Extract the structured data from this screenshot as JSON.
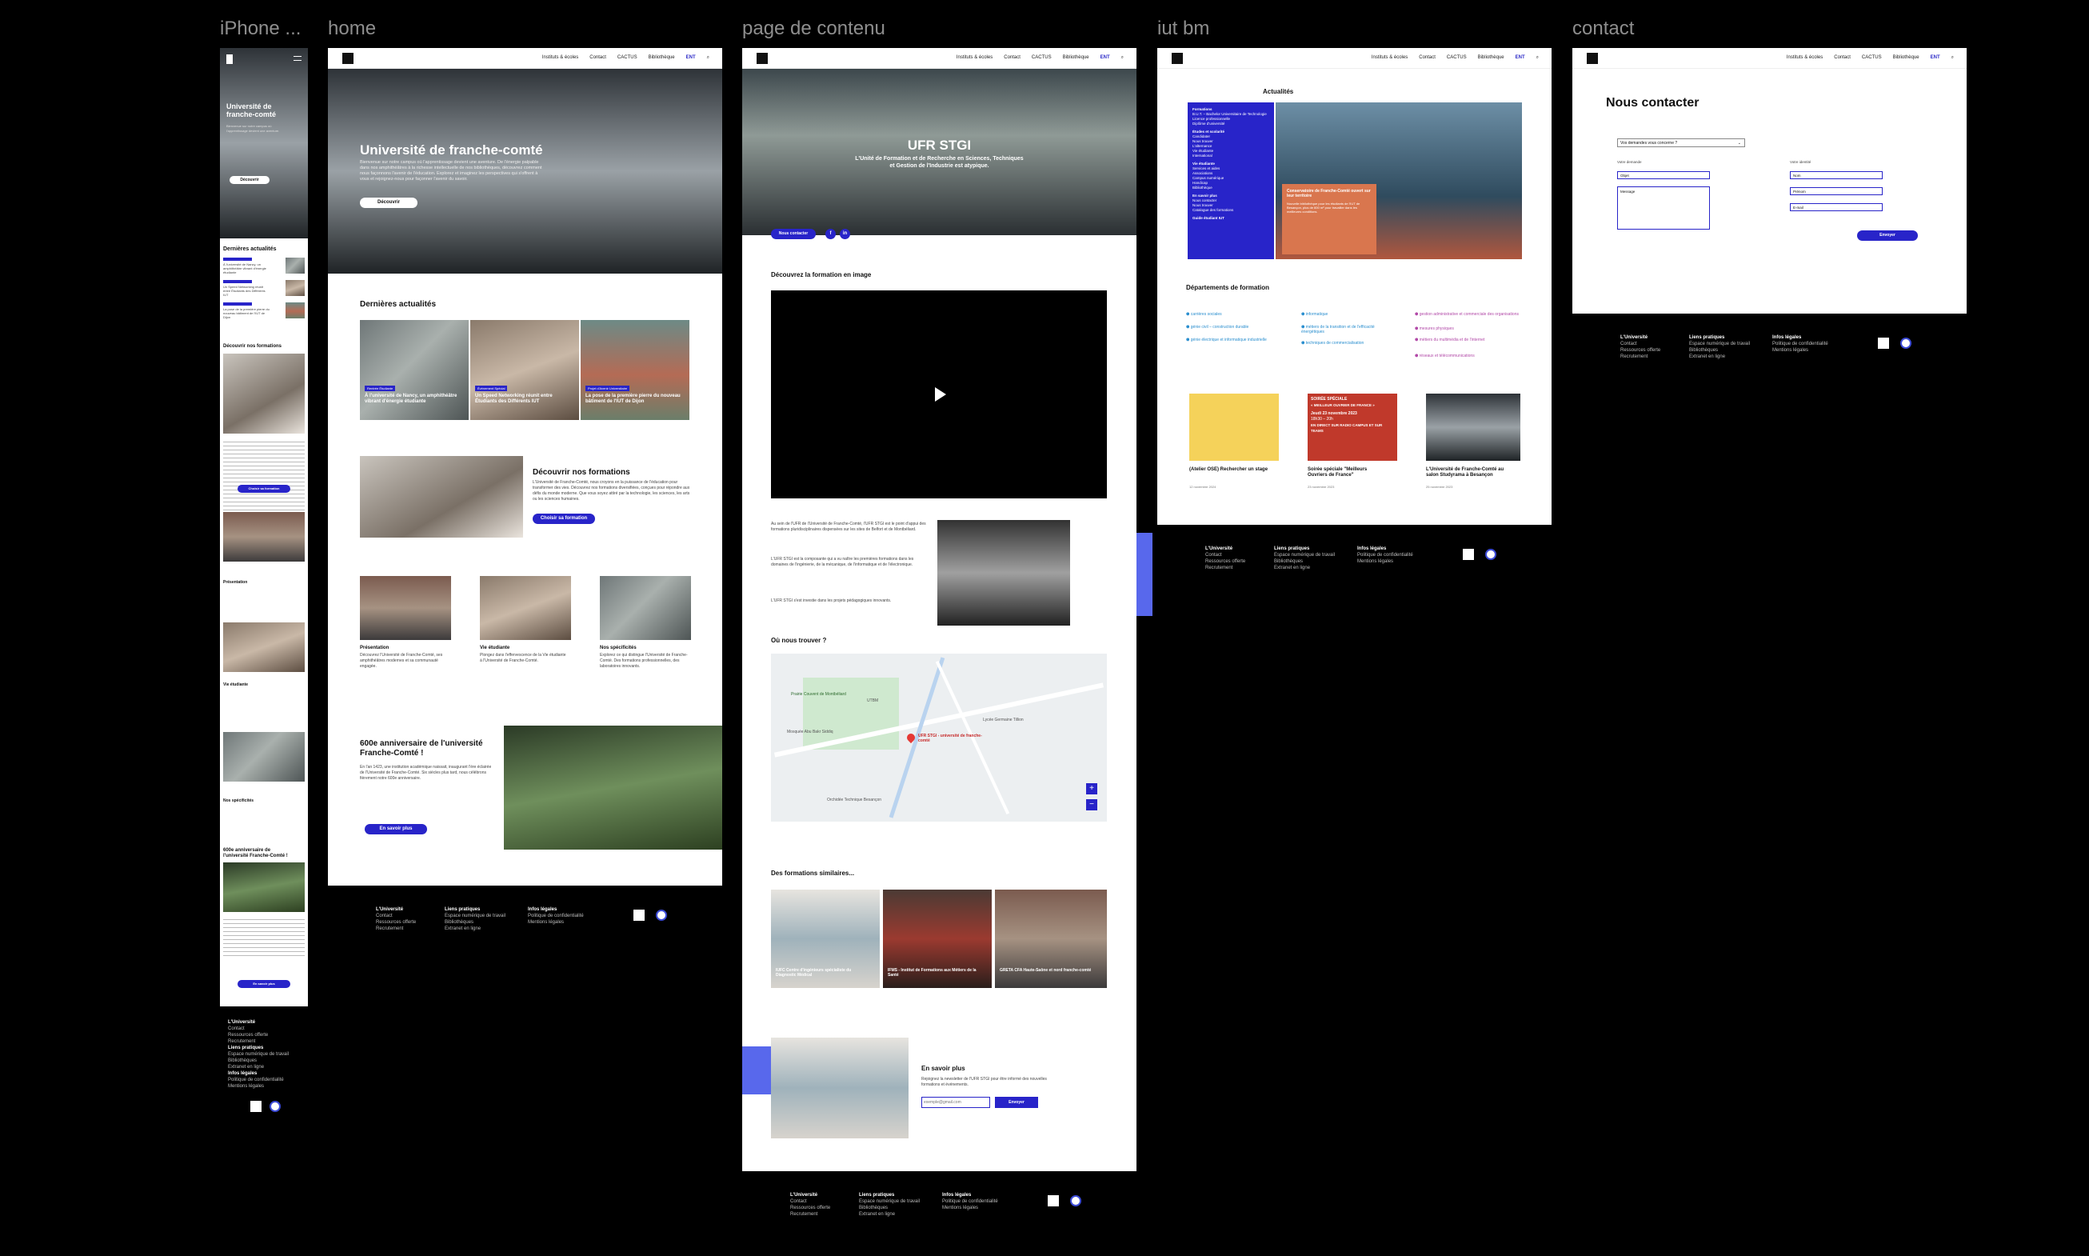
{
  "frames": {
    "iphone": "iPhone ...",
    "home": "home",
    "page": "page de contenu",
    "iut": "iut bm",
    "contact": "contact"
  },
  "nav": {
    "links": [
      "Instituts & écoles",
      "Contact",
      "CACTUS",
      "Bibliothèque",
      "ENT"
    ],
    "search_icon": "search-icon"
  },
  "iphone": {
    "hero_title": "Université de franche-comté",
    "hero_text": "Bienvenue sur notre campus où l'apprentissage devient une aventure.",
    "hero_button": "Découvrir",
    "news_title": "Dernières actualités",
    "news": [
      "À l'université de Nancy, un amphithéâtre vibrant d'énergie étudiante",
      "Un Speed Networking réunit entre Étudiants des Différents IUT",
      "La pose de la première pierre du nouveau bâtiment de l'IUT de Dijon"
    ],
    "formations_title": "Découvrir nos formations",
    "formations_button": "Choisir sa formation",
    "presentation": "Présentation",
    "vie": "Vie étudiante",
    "specificites": "Nos spécificités",
    "anniv_title": "600e anniversaire de l'université Franche-Comté !",
    "anniv_button": "En savoir plus"
  },
  "home": {
    "hero_title": "Université de franche-comté",
    "hero_text": "Bienvenue sur notre campus où l'apprentissage devient une aventure. De l'énergie palpable dans nos amphithéâtres à la richesse intellectuelle de nos bibliothèques, découvrez comment nous façonnons l'avenir de l'éducation. Explorez et imaginez les perspectives qui s'offrent à vous et rejoignez-nous pour façonner l'avenir du savoir.",
    "hero_button": "Découvrir",
    "news_title": "Dernières actualités",
    "news": [
      {
        "tag": "Rentrée Étudiante",
        "text": "À l'université de Nancy, un amphithéâtre vibrant d'énergie étudiante"
      },
      {
        "tag": "Événement Spécial",
        "text": "Un Speed Networking réunit entre Étudiants des Différents IUT"
      },
      {
        "tag": "Projet d'Avenir Universitaire",
        "text": "La pose de la première pierre du nouveau bâtiment de l'IUT de Dijon"
      }
    ],
    "formations_title": "Découvrir nos formations",
    "formations_text": "L'Université de Franche-Comté, nous croyons en la puissance de l'éducation pour transformer des vies. Découvrez nos formations diversifiées, conçues pour répondre aux défis du monde moderne. Que vous soyez attiré par la technologie, les sciences, les arts ou les sciences humaines.",
    "formations_button": "Choisir sa formation",
    "cards": [
      {
        "title": "Présentation",
        "text": "Découvrez l'Université de Franche-Comté, ses amphithéâtres modernes et sa communauté engagée."
      },
      {
        "title": "Vie étudiante",
        "text": "Plongez dans l'effervescence de la Vie étudiante à l'Université de Franche-Comté."
      },
      {
        "title": "Nos spécificités",
        "text": "Explorez ce qui distingue l'Université de Franche-Comté. Des formations professionnelles, des laboratoires innovants."
      }
    ],
    "anniv_title": "600e anniversaire de l'université Franche-Comté !",
    "anniv_text": "En l'an 1423, une institution académique naissait, inaugurant l'ère éclairée de l'Université de Franche-Comté. Six siècles plus tard, nous célébrons fièrement notre 600e anniversaire.",
    "anniv_button": "En savoir plus"
  },
  "page": {
    "hero_title": "UFR STGI",
    "hero_sub": "L'Unité de Formation et de Recherche en Sciences, Techniques et Gestion de l'Industrie est atypique.",
    "contact_button": "Nous contacter",
    "social_f": "f",
    "social_in": "in",
    "video_title": "Découvrez la formation en image",
    "play_icon": "play-icon",
    "text1": "Au sein de l'UFR de l'Université de Franche-Comté, l'UFR STGI est le point d'appui des formations pluridisciplinaires dispensées sur les sites de Belfort et de Montbéliard.",
    "text2": "L'UFR STGI est la composante qui a vu naître les premières formations dans les domaines de l'ingénierie, de la mécanique, de l'informatique et de l'électronique.",
    "text3": "L'UFR STGI s'est investie dans les projets pédagogiques innovants.",
    "map_title": "Où nous trouver ?",
    "map_marker": "UFR STGI - université de franche-comté",
    "map_labels": [
      "Prairie Couvent de Montbéliard",
      "UTBM",
      "Lycée Germaine Tillion",
      "Mosquée Abu Bakr Siddiq",
      "Orchidée Technique Besançon"
    ],
    "zoom_in": "+",
    "zoom_out": "−",
    "similar_title": "Des formations similaires...",
    "similar": [
      "IUFC Centre d'ingénieurs spécialiste du Diagnostic Médical",
      "IFMS - Institut de Formations aux Métiers de la Santé",
      "GRETA CFA Haute-Saône et nord franche-comté"
    ],
    "more_title": "En savoir plus",
    "more_text": "Rejoignez la newsletter de l'UFR STGI pour être informé des nouvelles formations et événements.",
    "email_placeholder": "exemple@gmail.com",
    "send_button": "Envoyer"
  },
  "iut": {
    "news_title": "Actualités",
    "side_sections": [
      {
        "h": "Formations",
        "items": [
          "B.U.T. – Bachelor Universitaire de Technologie",
          "Licence professionnelle",
          "Diplôme d'université"
        ]
      },
      {
        "h": "Études et scolarité",
        "items": [
          "Candidater",
          "Nous trouver",
          "L'alternance",
          "Vie étudiante",
          "International"
        ]
      },
      {
        "h": "Vie étudiante",
        "items": [
          "Services et aides",
          "Associations",
          "Campus numérique",
          "Handicap",
          "Bibliothèque"
        ]
      },
      {
        "h": "En savoir plus",
        "items": [
          "Nous contacter",
          "Nous trouver",
          "Catalogue des formations"
        ]
      },
      {
        "h": "Guide étudiant IUT",
        "items": []
      }
    ],
    "feature_title": "Conservatoire de Franche-Comté ouvert sur leur territoire",
    "feature_text": "Nouvelle bibliothèque pour les étudiants de l'IUT de Besançon, plus de 600 m² pour travailler dans les meilleures conditions.",
    "departements_title": "Départements de formation",
    "departements": [
      "carrières sociales",
      "génie civil – construction durable",
      "génie électrique et informatique industrielle",
      "informatique",
      "métiers de la transition et de l'efficacité énergétiques",
      "techniques de commercialisation",
      "gestion administrative et commerciale des organisations",
      "mesures physiques",
      "métiers du multimédia et de l'internet",
      "réseaux et télécommunications"
    ],
    "events": [
      {
        "title": "(Atelier OSE) Rechercher un stage",
        "date": "12 novembre 2024"
      },
      {
        "title": "Soirée spéciale \"Meilleurs Ouvriers de France\"",
        "date": "23 novembre 2023"
      },
      {
        "title": "L'Université de Franche-Comté au salon Studyrama à Besançon",
        "date": "25 novembre 2023"
      }
    ],
    "poster": {
      "l1": "SOIRÉE SPÉCIALE",
      "l2": "« MEILLEUR OUVRIER DE FRANCE »",
      "l3": "Jeudi 23 novembre 2023",
      "l4": "18h30 – 20h",
      "l5": "EN DIRECT SUR RADIO CAMPUS ET SUR TEAMS"
    }
  },
  "contact": {
    "title": "Nous contacter",
    "select_value": "Vos demandes vous concerne ?",
    "fields": {
      "nom_label": "Votre demande",
      "nom": "Objet",
      "message": "Message",
      "info_label": "Votre identité",
      "prenom": "Nom",
      "email": "Prénom",
      "tel": "E-mail"
    },
    "send": "Envoyer"
  },
  "footer": {
    "col1": {
      "h": "L'Université",
      "items": [
        "Contact",
        "Ressources offerte",
        "Recrutement"
      ]
    },
    "col2": {
      "h": "Liens pratiques",
      "items": [
        "Espace numérique de travail",
        "Bibliothèques",
        "Extranet en ligne"
      ]
    },
    "col3": {
      "h": "Infos légales",
      "items": [
        "Politique de confidentialité",
        "Mentions légales"
      ]
    }
  }
}
